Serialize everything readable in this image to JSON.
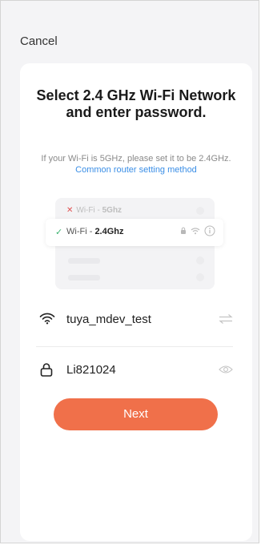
{
  "header": {
    "cancel_label": "Cancel"
  },
  "title": "Select 2.4 GHz Wi-Fi Network and enter password.",
  "subtitle": {
    "text": "If your Wi-Fi is 5GHz, please set it to be 2.4GHz.",
    "link": "Common router setting method"
  },
  "illustration": {
    "bad_row": {
      "prefix": "Wi-Fi - ",
      "band": "5Ghz"
    },
    "good_row": {
      "prefix": "Wi-Fi - ",
      "band": "2.4Ghz"
    }
  },
  "form": {
    "ssid_value": "tuya_mdev_test",
    "password_value": "Li821024"
  },
  "next_label": "Next",
  "colors": {
    "accent": "#f0704a",
    "link": "#3a8ee6",
    "check": "#3cb371",
    "error": "#e05050"
  }
}
